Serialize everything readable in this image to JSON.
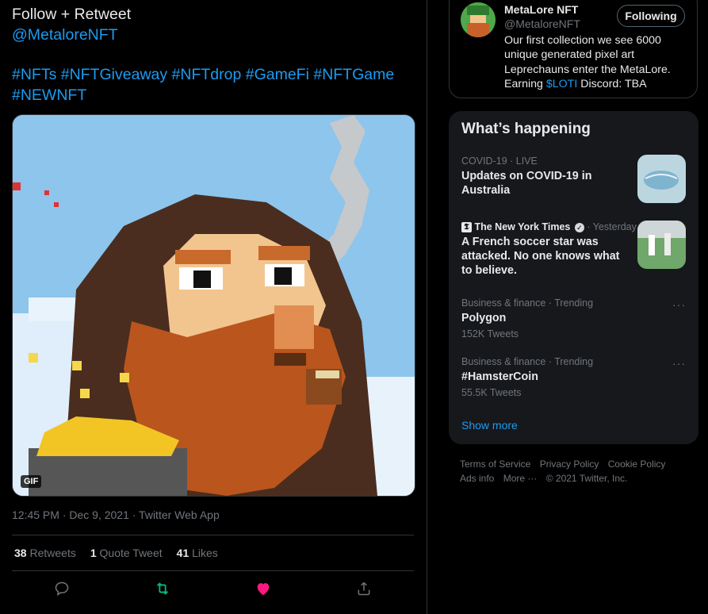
{
  "tweet": {
    "line1": "Follow + Retweet",
    "mention": "@MetaloreNFT",
    "hashtags_line1": "#NFTs #NFTGiveaway #NFTdrop #GameFi #NFTGame",
    "hashtags_line2": "#NEWNFT",
    "media_badge": "GIF",
    "timestamp": "12:45 PM · Dec 9, 2021 · Twitter Web App",
    "retweets_count": "38",
    "retweets_label": "Retweets",
    "quotes_count": "1",
    "quotes_label": "Quote Tweet",
    "likes_count": "41",
    "likes_label": "Likes",
    "actions": {
      "reply_icon": "reply-icon",
      "retweet_icon": "retweet-icon",
      "like_icon": "heart-icon",
      "share_icon": "share-icon"
    },
    "colors": {
      "retweet_active": "#00ba7c",
      "like_active": "#f91880",
      "link": "#1d9bf0"
    }
  },
  "profile": {
    "name": "MetaLore NFT",
    "handle": "@MetaloreNFT",
    "follow_button": "Following",
    "bio_text": "Our first collection we see 6000 unique generated pixel art Leprechauns enter the MetaLore. Earning ",
    "bio_cashtag": "$LOTI",
    "bio_tail": " Discord: TBA"
  },
  "happening": {
    "title": "What’s happening",
    "trends": [
      {
        "category": "COVID-19 · LIVE",
        "topic": "Updates on COVID-19 in Australia"
      },
      {
        "source": "The New York Times",
        "time": "· Yesterday",
        "topic": "A French soccer star was attacked. No one knows what to believe."
      },
      {
        "category": "Business & finance · Trending",
        "topic": "Polygon",
        "count": "152K Tweets"
      },
      {
        "category": "Business & finance · Trending",
        "topic": "#HamsterCoin",
        "count": "55.5K Tweets"
      }
    ],
    "show_more": "Show more"
  },
  "footer": {
    "terms": "Terms of Service",
    "privacy": "Privacy Policy",
    "cookie": "Cookie Policy",
    "ads": "Ads info",
    "more": "More ···",
    "copyright": "© 2021 Twitter, Inc."
  }
}
